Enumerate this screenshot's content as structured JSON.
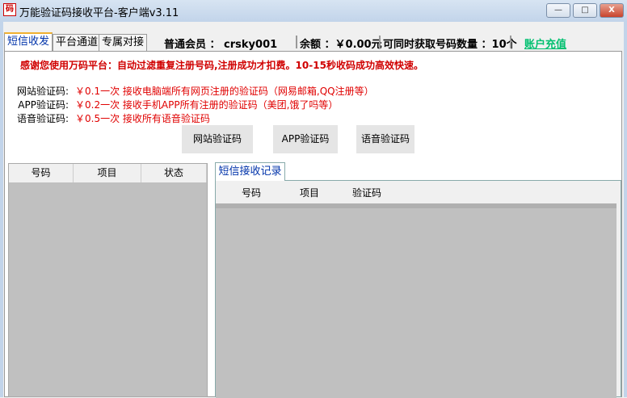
{
  "window": {
    "title": "万能验证码接收平台-客户端v3.11",
    "icon": "码",
    "minimize": "—",
    "maximize": "□",
    "close": "X"
  },
  "tabs": [
    {
      "label": "短信收发"
    },
    {
      "label": "平台通道"
    },
    {
      "label": "专属对接"
    }
  ],
  "status": {
    "member": "普通会员 ： crsky001",
    "balance": "余额 ：￥0.00元",
    "max_numbers": "可同时获取号码数量 ：10个",
    "recharge": "账户充值"
  },
  "notice": "感谢您使用万码平台：自动过滤重复注册号码,注册成功才扣费。10-15秒收码成功高效快速。",
  "pricing": [
    {
      "label": "网站验证码:",
      "desc": "￥0.1一次 接收电脑端所有网页注册的验证码（网易邮箱,QQ注册等）"
    },
    {
      "label": "APP验证码:",
      "desc": "￥0.2一次 接收手机APP所有注册的验证码（美团,饿了吗等）"
    },
    {
      "label": "语音验证码:",
      "desc": "￥0.5一次 接收所有语音验证码"
    }
  ],
  "buttons": {
    "web": "网站验证码",
    "app": "APP验证码",
    "voice": "语音验证码"
  },
  "left_table": {
    "columns": [
      "号码",
      "项目",
      "状态"
    ]
  },
  "right_panel": {
    "tab": "短信接收记录",
    "columns": [
      "号码",
      "项目",
      "验证码"
    ]
  }
}
